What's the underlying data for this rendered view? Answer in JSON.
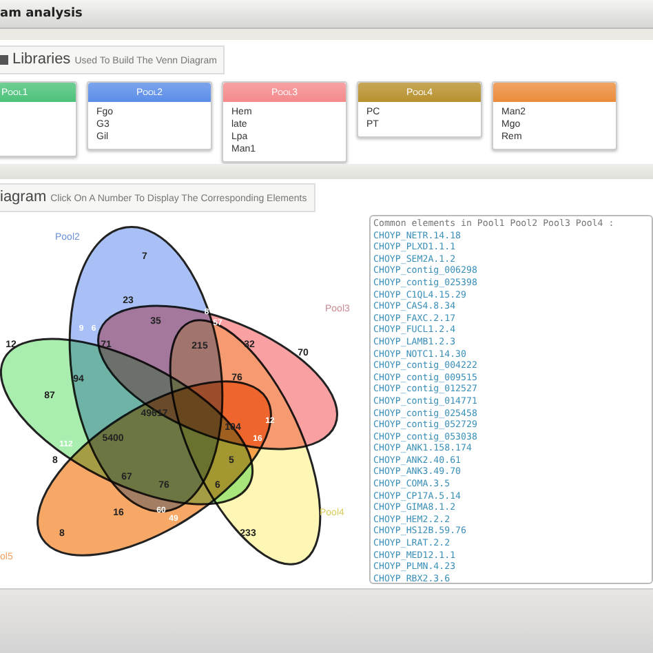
{
  "window": {
    "title": "am analysis"
  },
  "libraries": {
    "title": "Libraries",
    "subtitle": "Used To Build The Venn Diagram",
    "pools": [
      {
        "label": "Pool1",
        "color": "#4cc27a"
      },
      {
        "label": "Pool2",
        "color": "#5b8de8",
        "items": [
          "Fgo",
          "G3",
          "Gil"
        ]
      },
      {
        "label": "Pool3",
        "color": "#f58a8c",
        "items": [
          "Hem",
          "late",
          "Lpa",
          "Man1"
        ]
      },
      {
        "label": "Pool4",
        "color": "#b8912e",
        "items": [
          "PC",
          "PT"
        ]
      },
      {
        "color": "#ec8c3c",
        "items": [
          "Man2",
          "Mgo",
          "Rem"
        ]
      }
    ]
  },
  "diagram": {
    "title": "iagram",
    "subtitle": "Click On A Number To Display The Corresponding Elements",
    "sets": [
      {
        "label": "Pool2",
        "color": "#a8c0f5"
      },
      {
        "label": "Pool3",
        "color": "#f8a0a2"
      },
      {
        "color": "#a9eeae"
      },
      {
        "label": "Pool4",
        "color": "#fdf6b4"
      },
      {
        "label": "ol5",
        "color": "#f7a866"
      }
    ],
    "counts": [
      "7",
      "23",
      "8",
      "35",
      "57",
      "9",
      "6",
      "12",
      "71",
      "215",
      "32",
      "70",
      "94",
      "76",
      "87",
      "49617",
      "104",
      "12",
      "112",
      "5400",
      "8",
      "16",
      "67",
      "76",
      "6",
      "5",
      "16",
      "60",
      "49",
      "8",
      "233"
    ]
  },
  "elements": {
    "title": "Common elements in Pool1 Pool2 Pool3 Pool4 :",
    "items": [
      "CHOYP_NETR.14.18",
      "CHOYP_PLXD1.1.1",
      "CHOYP_SEM2A.1.2",
      "CHOYP_contig_006298",
      "CHOYP_contig_025398",
      "CHOYP_C1QL4.15.29",
      "CHOYP_CAS4.8.34",
      "CHOYP_FAXC.2.17",
      "CHOYP_FUCL1.2.4",
      "CHOYP_LAMB1.2.3",
      "CHOYP_NOTC1.14.30",
      "CHOYP_contig_004222",
      "CHOYP_contig_009515",
      "CHOYP_contig_012527",
      "CHOYP_contig_014771",
      "CHOYP_contig_025458",
      "CHOYP_contig_052729",
      "CHOYP_contig_053038",
      "CHOYP_ANK1.158.174",
      "CHOYP_ANK2.40.61",
      "CHOYP_ANK3.49.70",
      "CHOYP_COMA.3.5",
      "CHOYP_CP17A.5.14",
      "CHOYP_GIMA8.1.2",
      "CHOYP_HEM2.2.2",
      "CHOYP_HS12B.59.76",
      "CHOYP_LRAT.2.2",
      "CHOYP_MED12.1.1",
      "CHOYP_PLMN.4.23",
      "CHOYP_RBX2.3.6"
    ]
  }
}
